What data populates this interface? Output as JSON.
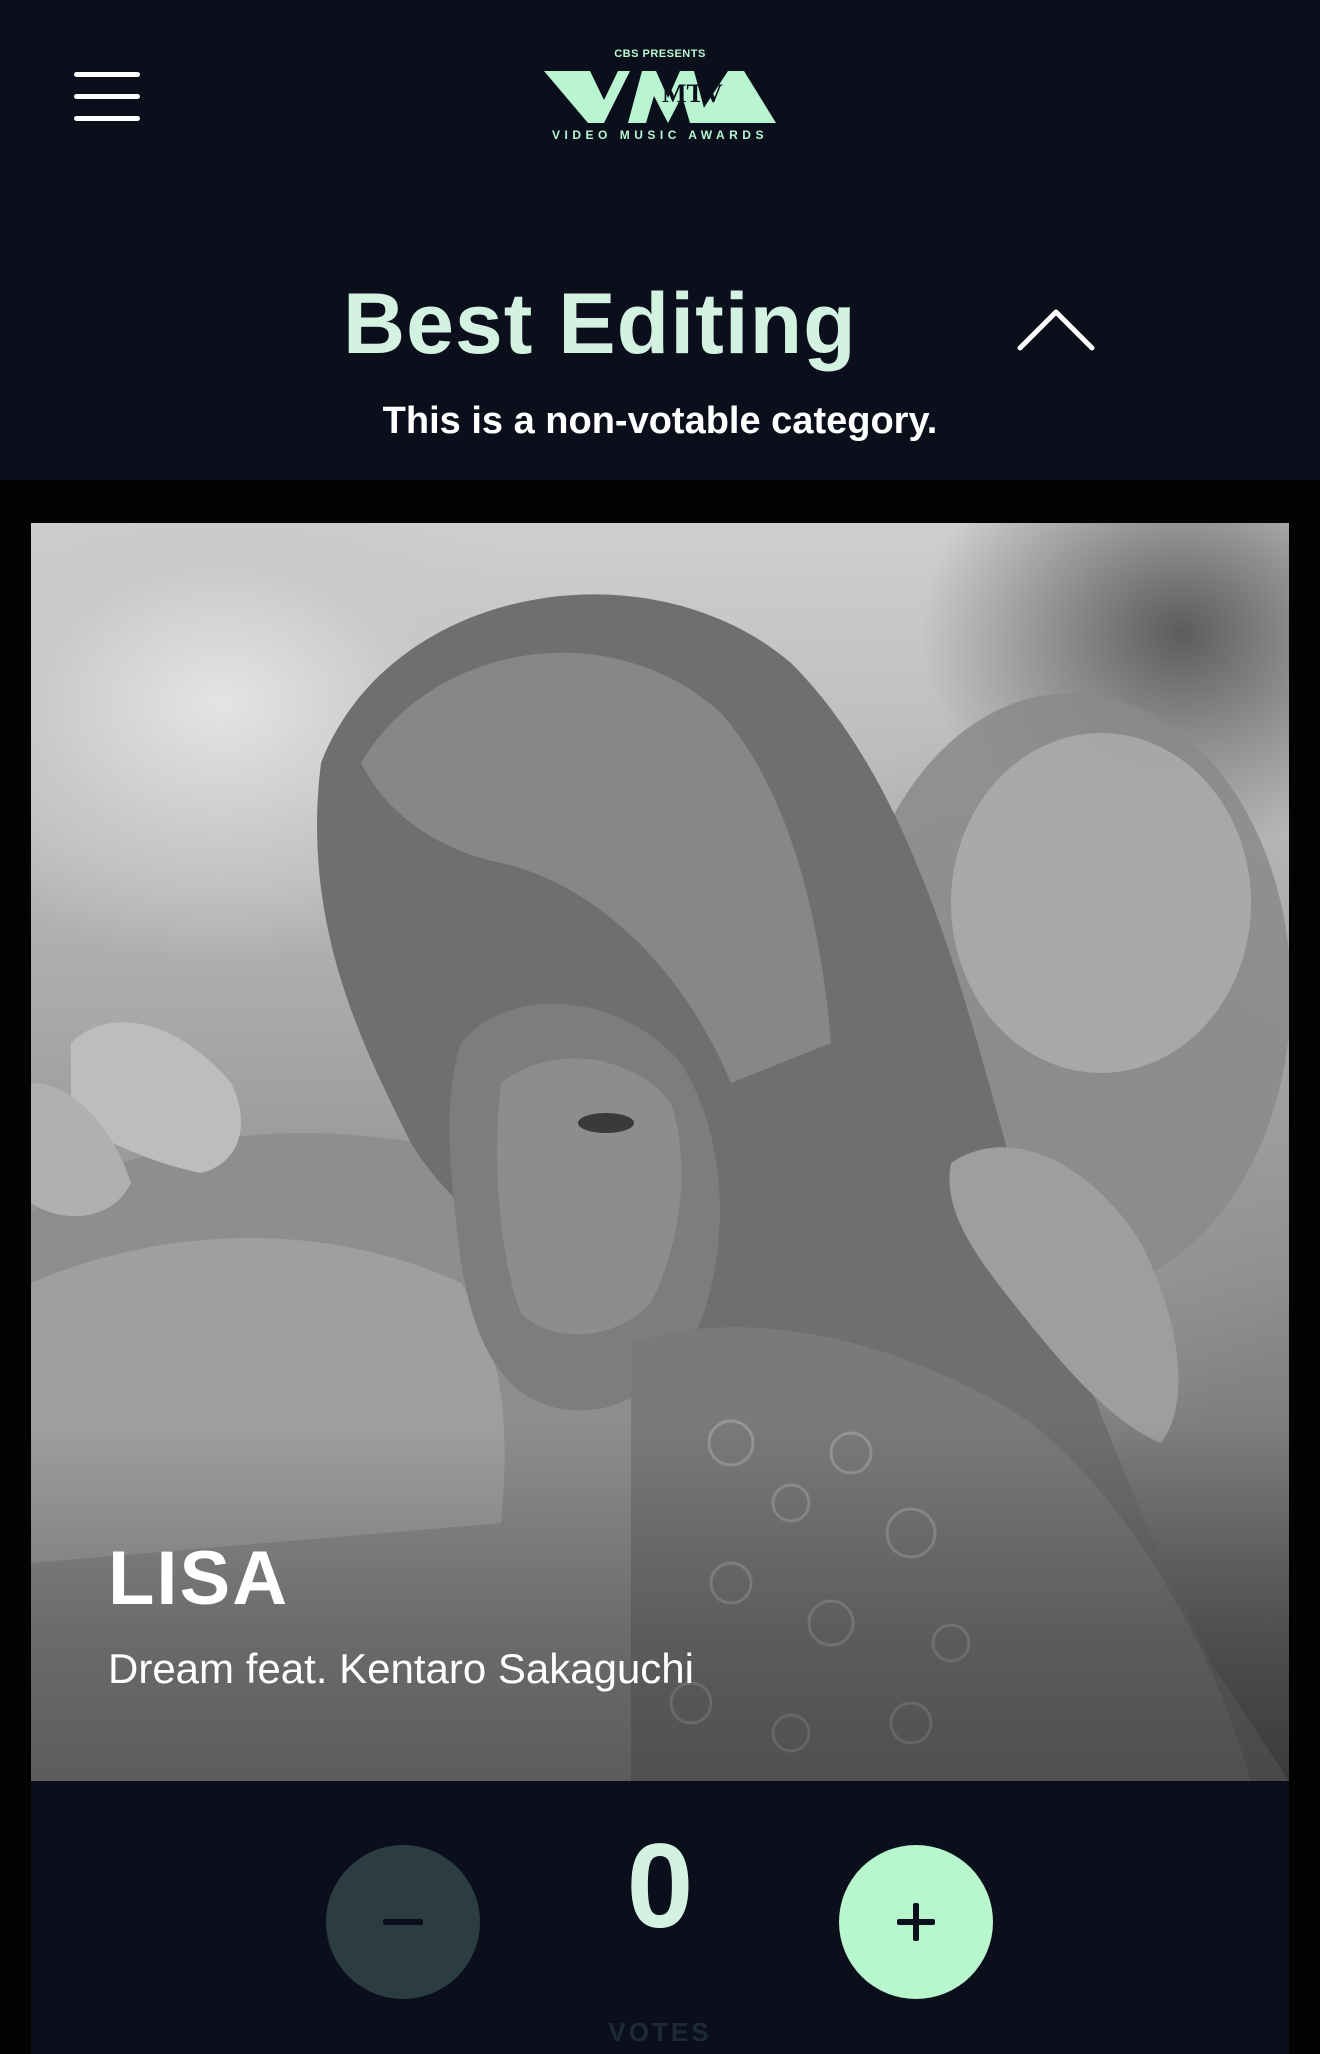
{
  "header": {
    "menu_icon": "hamburger-menu-icon",
    "logo": {
      "presents": "CBS PRESENTS",
      "wordmark": "VMA",
      "overlay": "MTV",
      "subtitle": "VIDEO MUSIC AWARDS"
    }
  },
  "category": {
    "title": "Best Editing",
    "toggle_icon": "chevron-up-icon",
    "note": "This is a non-votable category."
  },
  "nominee": {
    "artist": "LISA",
    "song": "Dream feat. Kentaro Sakaguchi"
  },
  "vote": {
    "count": "0",
    "label": "VOTES",
    "minus_icon": "minus-icon",
    "plus_icon": "plus-icon"
  },
  "colors": {
    "background": "#0b0f1c",
    "accent_mint": "#b8f7cd",
    "title_mint": "#d4f2e2",
    "minus_button": "#2b3d42"
  }
}
